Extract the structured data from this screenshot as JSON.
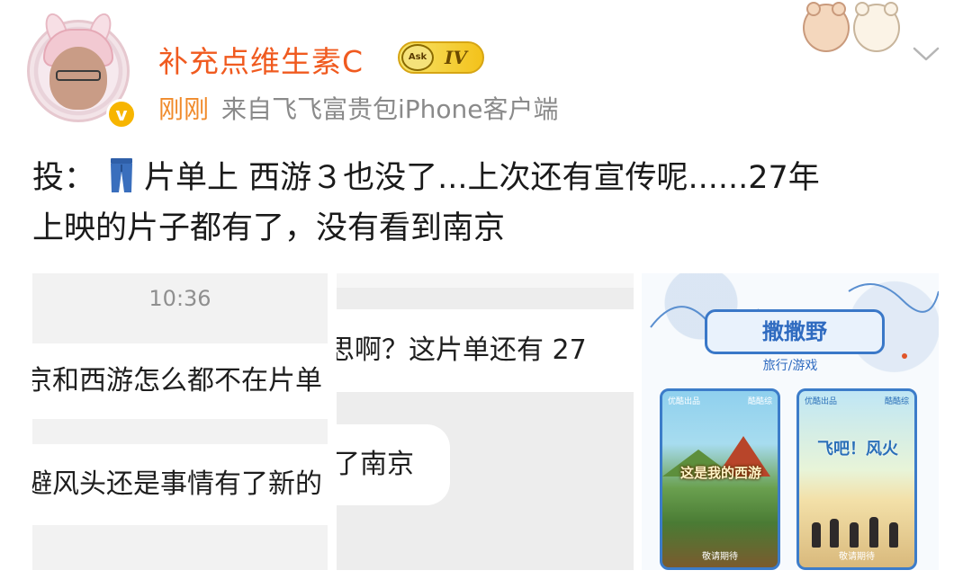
{
  "header": {
    "username": "补充点维生素C",
    "level": "IV",
    "level_logo": "Ask",
    "time": "刚刚",
    "source": "来自飞飞富贵包iPhone客户端",
    "verified_mark": "v"
  },
  "post": {
    "prefix": "投：",
    "line1_rest": "片单上 西游３也没了...上次还有宣传呢......27年",
    "line2": "上映的片子都有了，没有看到南京",
    "emoji_icon": "jeans-icon"
  },
  "images": {
    "chat1": {
      "time": "10:36",
      "message1": "京和西游怎么都不在片单",
      "message2": "避风头还是事情有了新的"
    },
    "chat2": {
      "message1": "思啊？这片单还有 27",
      "message2": "了南京"
    },
    "poster": {
      "title": "撒撒野",
      "subtitle": "旅行/游戏",
      "card1_tag_left": "优酷出品",
      "card1_tag_right": "酷酷综",
      "card1_title": "这是我的西游",
      "card1_footer": "敬请期待",
      "card2_tag_left": "优酷出品",
      "card2_tag_right": "酷酷综",
      "card2_title": "飞吧！风火",
      "card2_footer": "敬请期待"
    }
  },
  "colors": {
    "username": "#f05a1f",
    "time": "#f08a2a",
    "source": "#8a8a8a",
    "verified": "#f7b500"
  }
}
